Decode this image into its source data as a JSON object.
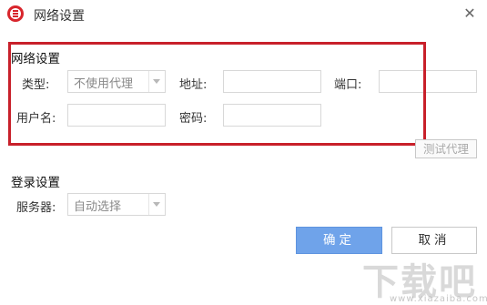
{
  "window": {
    "title": "网络设置",
    "close_symbol": "✕",
    "logo_color": "#d8252c"
  },
  "proxy_section": {
    "title": "网络设置",
    "type_label": "类型:",
    "type_value": "不使用代理",
    "address_label": "地址:",
    "address_value": "",
    "port_label": "端口:",
    "port_value": "",
    "username_label": "用户名:",
    "username_value": "",
    "password_label": "密码:",
    "password_value": "",
    "highlight_color": "#c8202a",
    "test_button": "测试代理"
  },
  "login_section": {
    "title": "登录设置",
    "server_label": "服务器:",
    "server_value": "自动选择"
  },
  "buttons": {
    "ok": "确定",
    "cancel": "取消",
    "ok_color": "#6fa3ea"
  },
  "watermark": {
    "main": "下载吧",
    "sub": "www.xiazaiba.com"
  }
}
